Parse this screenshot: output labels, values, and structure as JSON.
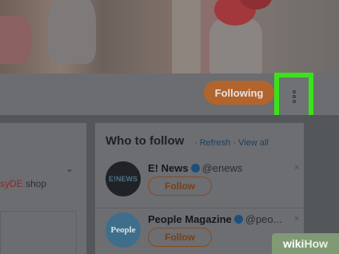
{
  "profile": {
    "following_label": "Following",
    "more_menu_icon": "vertical-dots-icon",
    "highlight_color": "#3ae21a",
    "accent_color": "#b2642d"
  },
  "left_card": {
    "shop_text_prefix": "syDE",
    "shop_text_suffix": " shop"
  },
  "who_to_follow": {
    "title": "Who to follow",
    "separator": "·",
    "refresh_label": "Refresh",
    "view_all_label": "View all",
    "accounts": [
      {
        "name": "E! News",
        "handle": "@enews",
        "follow_label": "Follow",
        "avatar_text": "E!NEWS"
      },
      {
        "name": "People Magazine",
        "handle": "@peo...",
        "follow_label": "Follow",
        "avatar_text": "People"
      }
    ],
    "dismiss_icon": "×"
  },
  "watermark": {
    "wiki": "wiki",
    "how": "How"
  }
}
